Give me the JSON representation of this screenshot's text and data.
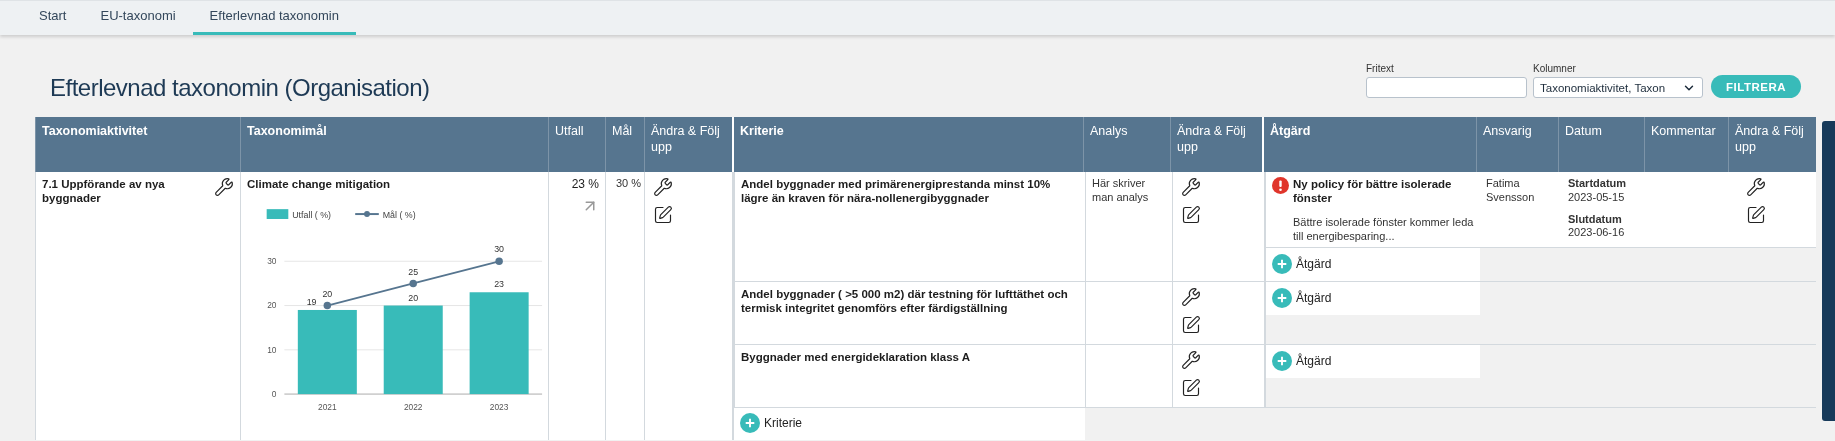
{
  "tabs": [
    {
      "label": "Start",
      "selected": false
    },
    {
      "label": "EU-taxonomi",
      "selected": false
    },
    {
      "label": "Efterlevnad taxonomin",
      "selected": true
    }
  ],
  "title": "Efterlevnad taxonomin (Organisation)",
  "filters": {
    "fritext": {
      "label": "Fritext"
    },
    "kolumner": {
      "label": "Kolumner",
      "value": "Taxonomiaktivitet, Taxon"
    },
    "button": "FILTRERA"
  },
  "table": {
    "columns": [
      "Taxonomiaktivitet",
      "Taxonomimål",
      "Utfall",
      "Mål",
      "Ändra & Följ upp",
      "Kriterie",
      "Analys",
      "Ändra & Följ upp",
      "Åtgärd",
      "Ansvarig",
      "Datum",
      "Kommentar",
      "Ändra & Följ upp"
    ],
    "activity": {
      "name": "7.1 Uppförande av nya byggnader",
      "goal": {
        "title": "Climate change mitigation",
        "chart_data": {
          "type": "bar",
          "categories": [
            "2021",
            "2022",
            "2023"
          ],
          "yticks": [
            0,
            10,
            20,
            30
          ],
          "ylim": [
            0,
            30
          ],
          "grid": true,
          "legend": "top",
          "data_labels": true,
          "series": [
            {
              "name": "Utfall ( %)",
              "type": "bar",
              "color": "#38bbb9",
              "values": [
                19,
                20,
                23
              ]
            },
            {
              "name": "Mål ( %)",
              "type": "line",
              "marker": "circle",
              "color": "#56758f",
              "values": [
                20,
                25,
                30
              ]
            }
          ]
        }
      },
      "outcome": "23 %",
      "target": "30 %",
      "criteria": [
        {
          "text": "Andel byggnader med primärenergiprestanda minst 10% lägre än kraven för nära-nollenergibyggnader",
          "analysis": "Här skriver man analys",
          "actions": [
            {
              "title": "Ny policy för bättre isolerade fönster",
              "flagged": true,
              "description": "Bättre isolerade fönster kommer leda till energibesparing...",
              "responsible": "Fatima Svensson",
              "start_label": "Startdatum",
              "start": "2023-05-15",
              "end_label": "Slutdatum",
              "end": "2023-06-16"
            }
          ],
          "add_action": "Åtgärd"
        },
        {
          "text": "Andel byggnader ( >5 000 m2) där testning för lufttäthet och termisk integritet genomförs efter färdigställning",
          "add_action": "Åtgärd"
        },
        {
          "text": "Byggnader med energideklaration klass A",
          "add_action": "Åtgärd"
        }
      ],
      "add_criterion": "Kriterie"
    }
  }
}
